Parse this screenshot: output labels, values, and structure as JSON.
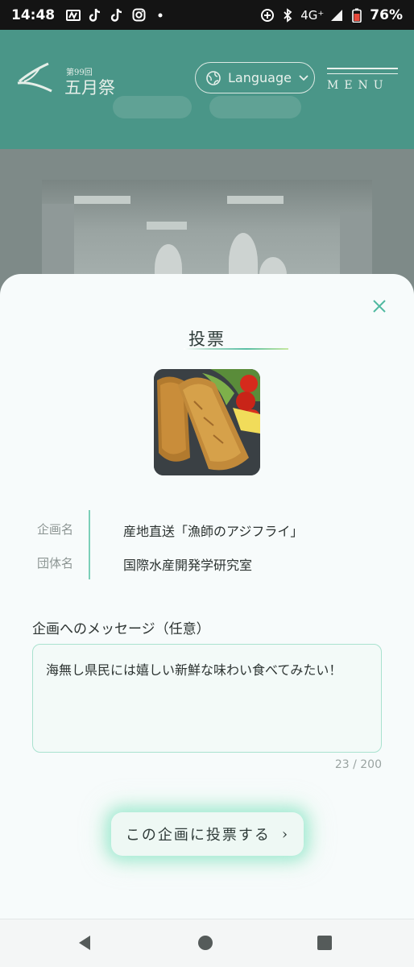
{
  "status_bar": {
    "time": "14:48",
    "network": "4G⁺",
    "battery": "76%"
  },
  "site_header": {
    "logo_small": "第99回",
    "logo_text": "五月祭",
    "language_label": "Language",
    "menu_label": "MENU"
  },
  "modal": {
    "title": "投票",
    "fields": [
      {
        "label": "企画名",
        "value": "産地直送「漁師のアジフライ」"
      },
      {
        "label": "団体名",
        "value": "国際水産開発学研究室"
      }
    ],
    "message_label": "企画へのメッセージ（任意）",
    "message_value": "海無し県民には嬉しい新鮮な味わい食べてみたい！",
    "char_count": "23 / 200",
    "vote_button_label": "この企画に投票する",
    "vote_button_arrow": "›"
  },
  "colors": {
    "accent": "#5bbfa5",
    "header_bg": "#4a9688",
    "sheet_bg": "#f7fbfb"
  }
}
